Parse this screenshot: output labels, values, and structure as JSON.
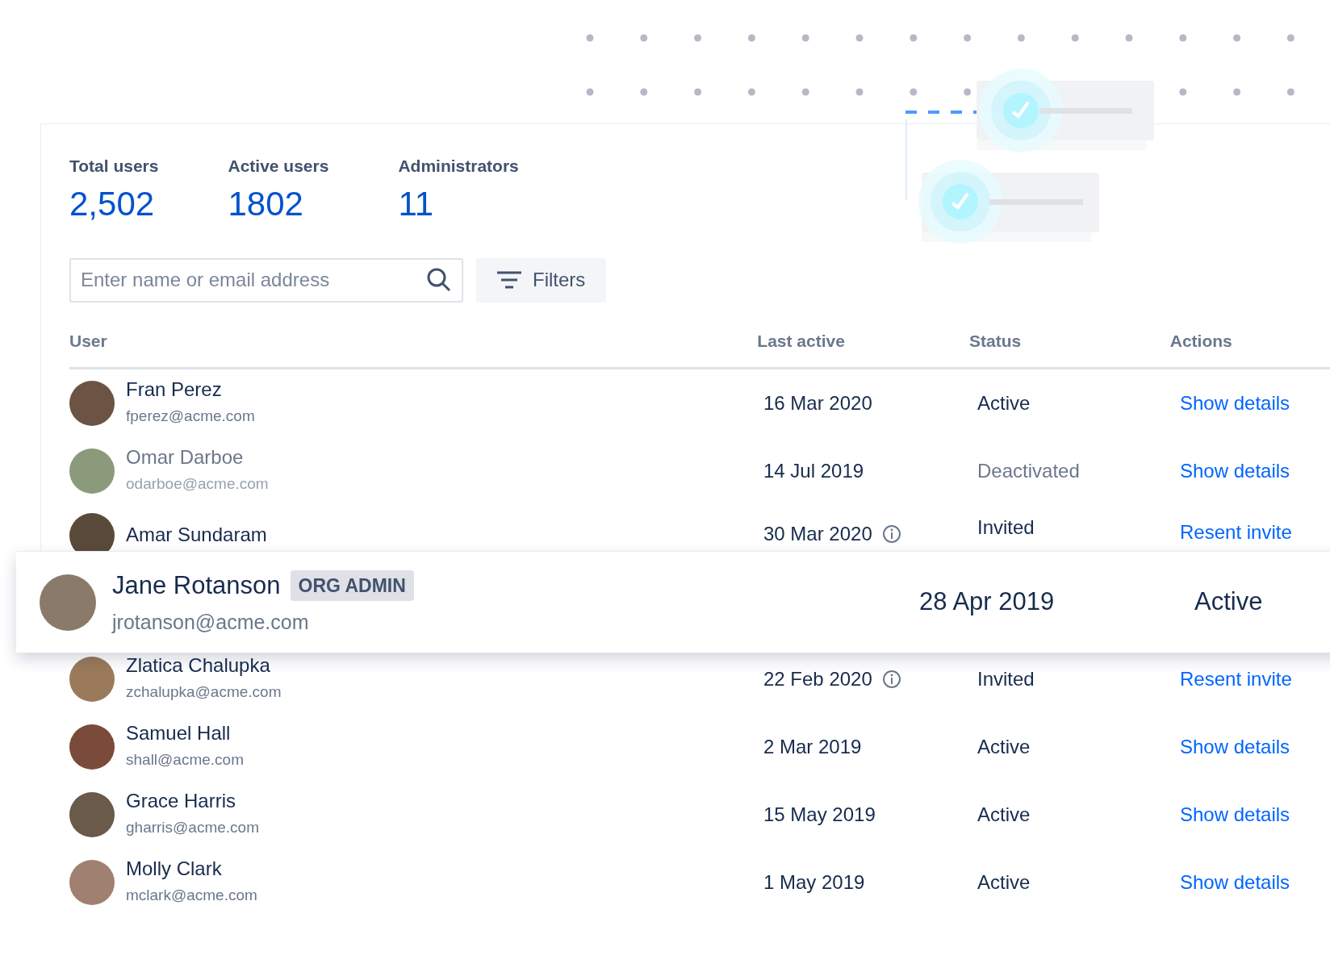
{
  "stats": [
    {
      "label": "Total users",
      "value": "2,502"
    },
    {
      "label": "Active users",
      "value": "1802"
    },
    {
      "label": "Administrators",
      "value": "11"
    }
  ],
  "search": {
    "placeholder": "Enter name or email address"
  },
  "filters_button": {
    "label": "Filters"
  },
  "table": {
    "columns": [
      "User",
      "Last active",
      "Status",
      "Actions"
    ],
    "rows": [
      {
        "name": "Fran Perez",
        "email": "fperez@acme.com",
        "last_active": "16 Mar 2020",
        "info": false,
        "status": "Active",
        "kind": "active",
        "action": "Show details"
      },
      {
        "name": "Omar Darboe",
        "email": "odarboe@acme.com",
        "last_active": "14 Jul 2019",
        "info": false,
        "status": "Deactivated",
        "kind": "deactivated",
        "action": "Show details"
      },
      {
        "name": "Amar Sundaram",
        "last_active": "30 Mar 2020",
        "info": true,
        "status": "Invited",
        "kind": "invited",
        "action": "Resent invite"
      },
      {
        "name": "Zlatica Chalupka",
        "email": "zchalupka@acme.com",
        "last_active": "22 Feb 2020",
        "info": true,
        "status": "Invited",
        "kind": "invited",
        "action": "Resent invite"
      },
      {
        "name": "Samuel Hall",
        "email": "shall@acme.com",
        "last_active": "2 Mar 2019",
        "info": false,
        "status": "Active",
        "kind": "active",
        "action": "Show details"
      },
      {
        "name": "Grace Harris",
        "email": "gharris@acme.com",
        "last_active": "15 May 2019",
        "info": false,
        "status": "Active",
        "kind": "active",
        "action": "Show details"
      },
      {
        "name": "Molly Clark",
        "email": "mclark@acme.com",
        "last_active": "1 May 2019",
        "info": false,
        "status": "Active",
        "kind": "active",
        "action": "Show details"
      }
    ]
  },
  "highlight_card": {
    "name": "Jane Rotanson",
    "badge": "ORG ADMIN",
    "email": "jrotanson@acme.com",
    "last_active": "28 Apr 2019",
    "status": "Active"
  }
}
